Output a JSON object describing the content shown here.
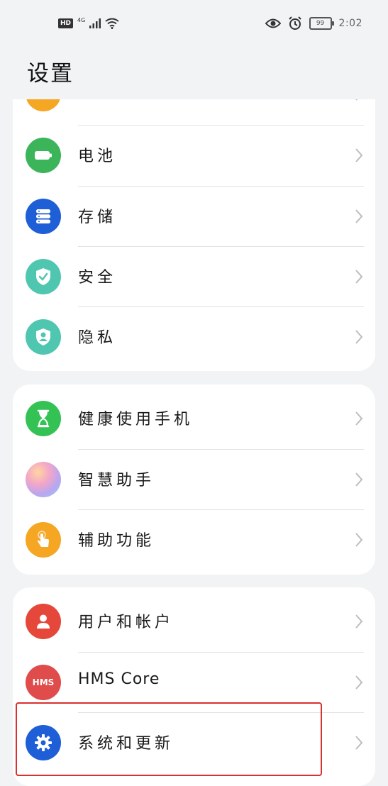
{
  "status_bar": {
    "hd": "HD",
    "network": "4G",
    "battery": "99",
    "time": "2:02"
  },
  "page": {
    "title": "设置"
  },
  "groups": [
    {
      "items": [
        {
          "label": "",
          "icon": "orange-partial-icon",
          "color": "#f5a623"
        },
        {
          "label": "电池",
          "icon": "battery-icon",
          "color": "#3cb55a"
        },
        {
          "label": "存储",
          "icon": "storage-icon",
          "color": "#1e5ed6"
        },
        {
          "label": "安全",
          "icon": "shield-icon",
          "color": "#4fc6b0"
        },
        {
          "label": "隐私",
          "icon": "privacy-icon",
          "color": "#4fc6b0"
        }
      ]
    },
    {
      "items": [
        {
          "label": "健康使用手机",
          "icon": "hourglass-icon",
          "color": "#35c255"
        },
        {
          "label": "智慧助手",
          "icon": "assistant-orb-icon",
          "color": "#c9a0e8"
        },
        {
          "label": "辅助功能",
          "icon": "hand-touch-icon",
          "color": "#f5a623"
        }
      ]
    },
    {
      "items": [
        {
          "label": "用户和帐户",
          "icon": "user-icon",
          "color": "#e5483a"
        },
        {
          "label": "HMS Core",
          "icon": "hms-icon",
          "color": "#e04b4b",
          "icon_text": "HMS"
        },
        {
          "label": "系统和更新",
          "icon": "gear-icon",
          "color": "#1e5ed6"
        }
      ]
    }
  ]
}
